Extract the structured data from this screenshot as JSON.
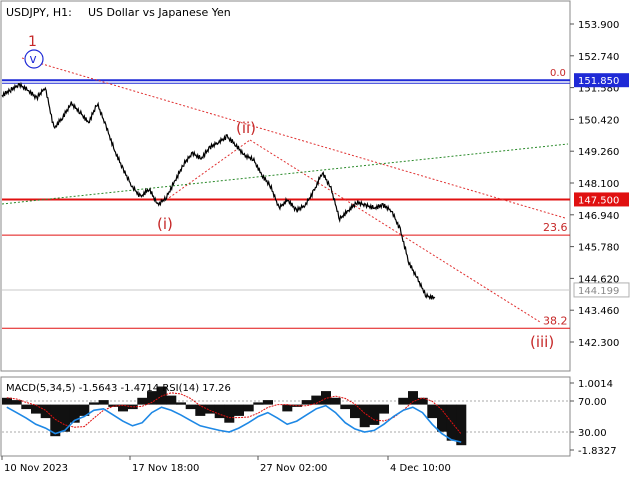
{
  "header": {
    "symbol": "USDJPY, H1:",
    "description": "US Dollar vs Japanese Yen"
  },
  "indicator_label": "MACD(5,34,5) -1.5643 -1.4714 RSI(14) 17.26",
  "colors": {
    "price": "#000000",
    "axis": "#555555",
    "blue_line": "#1f2ad6",
    "red_line": "#e01010",
    "dotted_red": "#e03030",
    "dotted_green": "#2a8a2a",
    "wave_label": "#c62828",
    "rsi": "#1e88e5",
    "price_tag_gray": "#b0b0b0"
  },
  "chart_data": [
    {
      "type": "line",
      "title": "USDJPY, H1: US Dollar vs Japanese Yen",
      "y_ticks": [
        "153.900",
        "152.740",
        "151.580",
        "150.420",
        "149.260",
        "148.100",
        "146.940",
        "145.780",
        "144.620",
        "143.460",
        "142.300"
      ],
      "ylim": [
        141.9,
        154.5
      ],
      "x_ticks": [
        "10 Nov 2023",
        "17 Nov 18:00",
        "27 Nov 02:00",
        "4 Dec 10:00"
      ],
      "series": [
        {
          "x": [
            0,
            0.02,
            0.04,
            0.06,
            0.08,
            0.1,
            0.12,
            0.14,
            0.16,
            0.18,
            0.2,
            0.22,
            0.24,
            0.26,
            0.28,
            0.3,
            0.32,
            0.34,
            0.36,
            0.38,
            0.4,
            0.42,
            0.44,
            0.46,
            0.48,
            0.5,
            0.52,
            0.54,
            0.56,
            0.58,
            0.6,
            0.62,
            0.64,
            0.66,
            0.68,
            0.7,
            0.72,
            0.74,
            0.76,
            0.78,
            0.8,
            0.82,
            0.84,
            0.86,
            0.88,
            0.9,
            0.92,
            0.94,
            0.96,
            0.98,
            1.0
          ],
          "values": [
            151.3,
            151.5,
            151.7,
            151.5,
            151.2,
            151.6,
            150.1,
            150.5,
            151.0,
            150.7,
            150.3,
            151.0,
            150.2,
            149.3,
            148.6,
            148.0,
            147.6,
            147.9,
            147.3,
            147.6,
            148.2,
            148.8,
            149.2,
            149.0,
            149.4,
            149.6,
            149.8,
            149.5,
            149.1,
            149.0,
            148.4,
            148.0,
            147.2,
            147.5,
            147.1,
            147.3,
            147.8,
            148.5,
            147.9,
            146.8,
            147.1,
            147.4,
            147.3,
            147.2,
            147.3,
            147.1,
            146.4,
            145.2,
            144.6,
            144.0,
            143.9
          ]
        }
      ],
      "levels": [
        {
          "name": "0.0",
          "value": 151.85,
          "tag": "151.850"
        },
        {
          "name": "",
          "value": 147.5,
          "tag": "147.500"
        },
        {
          "name": "23.6",
          "value": 146.2,
          "tag": ""
        },
        {
          "name": "38.2",
          "value": 142.8,
          "tag": ""
        },
        {
          "name": "",
          "value": 144.199,
          "tag": "144.199"
        }
      ],
      "wave_labels": [
        "1",
        "v",
        "(i)",
        "(ii)",
        "(iii)"
      ]
    },
    {
      "type": "bar",
      "title": "MACD(5,34,5) -1.5643 -1.4714 RSI(14) 17.26",
      "y_ticks": [
        "1.0014",
        "70.00",
        "30.00",
        "-1.8327"
      ],
      "values": [
        0.3,
        0.2,
        -0.2,
        -0.4,
        -0.6,
        -1.4,
        -1.2,
        -0.8,
        -0.5,
        0.1,
        0.2,
        -0.1,
        -0.3,
        -0.2,
        0.3,
        0.6,
        0.8,
        0.4,
        0.1,
        -0.2,
        -0.5,
        -0.4,
        -0.6,
        -0.8,
        -0.5,
        -0.3,
        0.1,
        0.2,
        0.0,
        -0.3,
        -0.1,
        0.2,
        0.4,
        0.6,
        0.3,
        -0.2,
        -0.6,
        -1.0,
        -0.9,
        -0.4,
        0.0,
        0.3,
        0.6,
        0.3,
        -0.6,
        -1.2,
        -1.6,
        -1.8
      ],
      "rsi": [
        62,
        55,
        48,
        40,
        35,
        28,
        32,
        45,
        50,
        58,
        60,
        52,
        44,
        38,
        42,
        55,
        62,
        58,
        52,
        45,
        38,
        35,
        32,
        30,
        35,
        42,
        50,
        55,
        48,
        40,
        44,
        52,
        60,
        64,
        55,
        42,
        34,
        30,
        32,
        40,
        50,
        58,
        62,
        55,
        40,
        28,
        20,
        17
      ]
    }
  ]
}
